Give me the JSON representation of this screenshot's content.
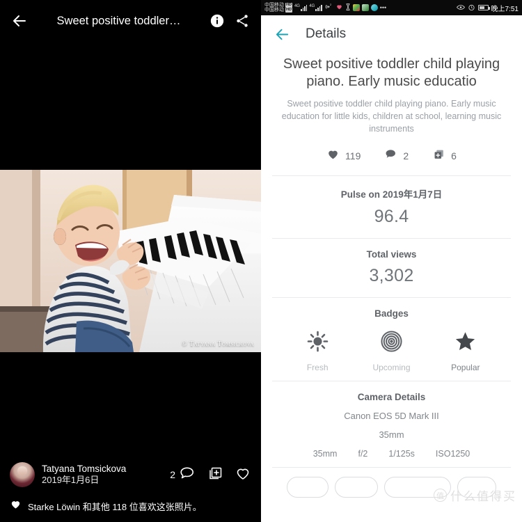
{
  "statusbar": {
    "carrier_1": "中国移动",
    "carrier_2": "中国移动",
    "hd_badge": "HD",
    "net_1": "4G",
    "net_2": "4G",
    "hotspot_count": "2",
    "time": "晚上7:51",
    "icons": [
      "hotspot-icon",
      "heart-icon",
      "hourglass-icon",
      "app-icon-1",
      "app-icon-2",
      "app-icon-3",
      "more-icon",
      "eye-icon",
      "alarm-icon",
      "battery-icon"
    ]
  },
  "viewer": {
    "back_label": "←",
    "title": "Sweet positive toddler…",
    "info_label": "i",
    "share_label": "share",
    "photo_watermark": "© Tatyana Tomsickova",
    "author": {
      "name": "Tatyana Tomsickova",
      "date": "2019年1月6日"
    },
    "actions": {
      "comment_count": "2",
      "collection_label": "add-to-collection",
      "like_label": "like"
    },
    "likes_text": "Starke Löwin 和其他 118 位喜欢这张照片。"
  },
  "details": {
    "back_label": "←",
    "header_title": "Details",
    "title": "Sweet positive toddler child playing piano. Early music educatio",
    "description": "Sweet positive toddler child playing piano. Early music education for little kids, children at school, learning music instruments",
    "stats": [
      {
        "icon": "heart-icon",
        "value": "119"
      },
      {
        "icon": "comment-icon",
        "value": "2"
      },
      {
        "icon": "collection-icon",
        "value": "6"
      }
    ],
    "pulse": {
      "title": "Pulse on 2019年1月7日",
      "value": "96.4"
    },
    "views": {
      "title": "Total views",
      "value": "3,302"
    },
    "badges": {
      "title": "Badges",
      "items": [
        {
          "icon": "sun-icon",
          "label": "Fresh",
          "active": false
        },
        {
          "icon": "target-icon",
          "label": "Upcoming",
          "active": false
        },
        {
          "icon": "star-icon",
          "label": "Popular",
          "active": true
        }
      ]
    },
    "camera": {
      "title": "Camera Details",
      "model": "Canon EOS 5D Mark III",
      "lens": "35mm",
      "specs": [
        "35mm",
        "f/2",
        "1/125s",
        "ISO1250"
      ]
    },
    "tags": [
      "",
      "",
      "",
      ""
    ]
  },
  "watermark": {
    "logo": "值",
    "text": "什么值得买"
  },
  "colors": {
    "accent_teal": "#1aa3b5",
    "panel_bg": "#ffffff",
    "viewer_bg": "#000000",
    "text_primary": "#3c4043",
    "text_secondary": "#80868b",
    "divider": "#e8eaed"
  }
}
